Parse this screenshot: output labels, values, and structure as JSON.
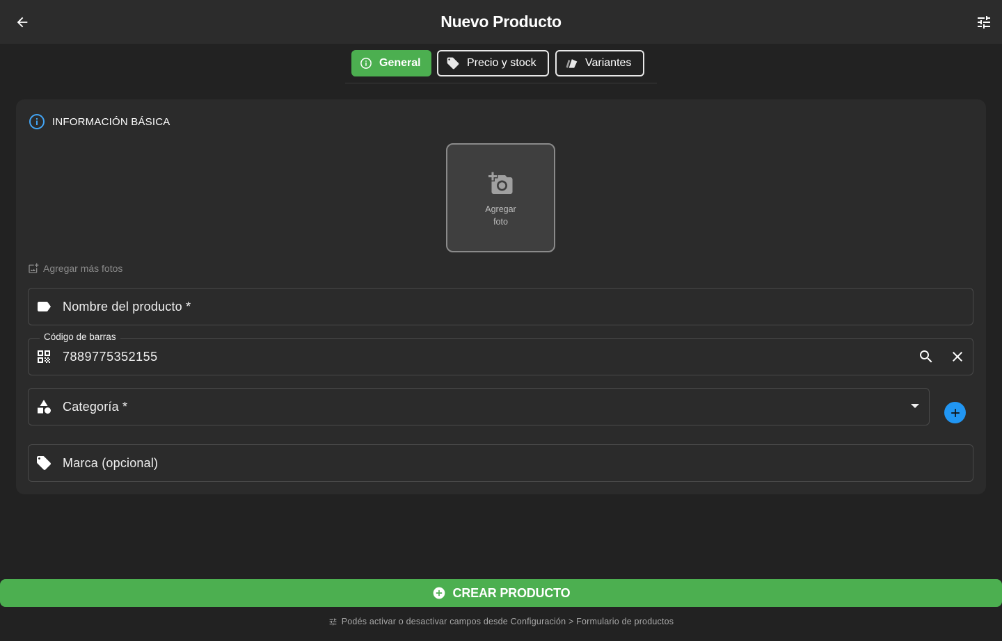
{
  "appbar": {
    "title": "Nuevo Producto",
    "back_icon": "arrow-back-icon",
    "settings_icon": "tune-icon"
  },
  "tabs": [
    {
      "label": "General",
      "icon": "info-icon",
      "active": true
    },
    {
      "label": "Precio y stock",
      "icon": "tag-icon",
      "active": false
    },
    {
      "label": "Variantes",
      "icon": "variants-icon",
      "active": false
    }
  ],
  "section": {
    "title": "INFORMACIÓN BÁSICA",
    "icon": "info-icon"
  },
  "photo": {
    "line1": "Agregar",
    "line2": "foto",
    "icon": "add-photo-icon"
  },
  "more_photos": {
    "label": "Agregar más fotos",
    "icon": "add-photo-alternate-icon"
  },
  "fields": {
    "name": {
      "placeholder": "Nombre del producto *",
      "icon": "label-icon"
    },
    "barcode": {
      "label": "Código de barras",
      "value": "7889775352155",
      "icon": "qr-code-icon"
    },
    "category": {
      "placeholder": "Categoría *",
      "icon": "category-icon"
    },
    "brand": {
      "placeholder": "Marca (opcional)",
      "icon": "tag-icon"
    }
  },
  "create_button": {
    "label": "CREAR PRODUCTO"
  },
  "hint": {
    "text": "Podés activar o desactivar campos desde Configuración > Formulario de productos"
  },
  "colors": {
    "primary_green": "#4caf50",
    "accent_blue": "#2196f3",
    "info_blue": "#42a5f5",
    "background": "#222222",
    "card": "#2b2b2b"
  }
}
